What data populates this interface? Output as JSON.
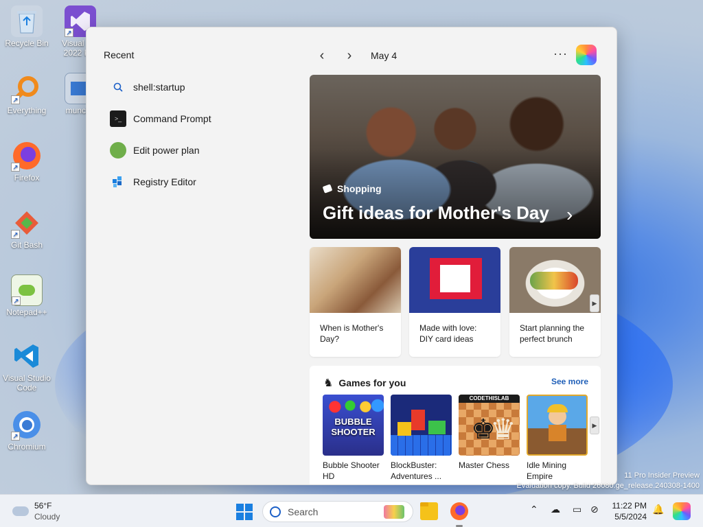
{
  "desktop": {
    "icons": [
      {
        "label": "Recycle Bin",
        "icon": "recycle-bin-icon"
      },
      {
        "label": "Visual S... 2022 Pre",
        "icon": "visual-studio-icon"
      },
      {
        "label": "Everything",
        "icon": "everything-search-icon"
      },
      {
        "label": "munche",
        "icon": "app-icon"
      },
      {
        "label": "Firefox",
        "icon": "firefox-icon"
      },
      {
        "label": "Git Bash",
        "icon": "git-bash-icon"
      },
      {
        "label": "Notepad++",
        "icon": "notepadpp-icon"
      },
      {
        "label": "Visual Studio Code",
        "icon": "vscode-icon"
      },
      {
        "label": "Chromium",
        "icon": "chromium-icon"
      }
    ]
  },
  "start_panel": {
    "recent_title": "Recent",
    "recent_items": [
      {
        "label": "shell:startup",
        "icon": "search-icon"
      },
      {
        "label": "Command Prompt",
        "icon": "command-prompt-icon"
      },
      {
        "label": "Edit power plan",
        "icon": "power-plan-icon"
      },
      {
        "label": "Registry Editor",
        "icon": "registry-editor-icon"
      }
    ],
    "date": "May 4",
    "more_label": "···",
    "hero": {
      "category": "Shopping",
      "headline": "Gift ideas for Mother's Day",
      "chevron": "›"
    },
    "cards": [
      {
        "title": "When is Mother's Day?"
      },
      {
        "title": "Made with love: DIY card ideas"
      },
      {
        "title": "Start planning the perfect brunch"
      }
    ],
    "games": {
      "title": "Games for you",
      "see_more": "See more",
      "items": [
        {
          "name": "Bubble Shooter HD",
          "thumb_text": "BUBBLE SHOOTER"
        },
        {
          "name": "BlockBuster: Adventures ..."
        },
        {
          "name": "Master Chess",
          "thumb_text": "CODETHISLAB"
        },
        {
          "name": "Idle Mining Empire"
        }
      ]
    }
  },
  "watermark": {
    "line1": "11 Pro Insider Preview",
    "line2": "Evaluation copy. Build 26080.ge_release.240308-1400"
  },
  "taskbar": {
    "weather_temp": "56°F",
    "weather_cond": "Cloudy",
    "search_placeholder": "Search",
    "time": "11:22 PM",
    "date": "5/5/2024"
  },
  "colors": {
    "accent": "#1a7fe0",
    "link": "#1f5fb8"
  }
}
